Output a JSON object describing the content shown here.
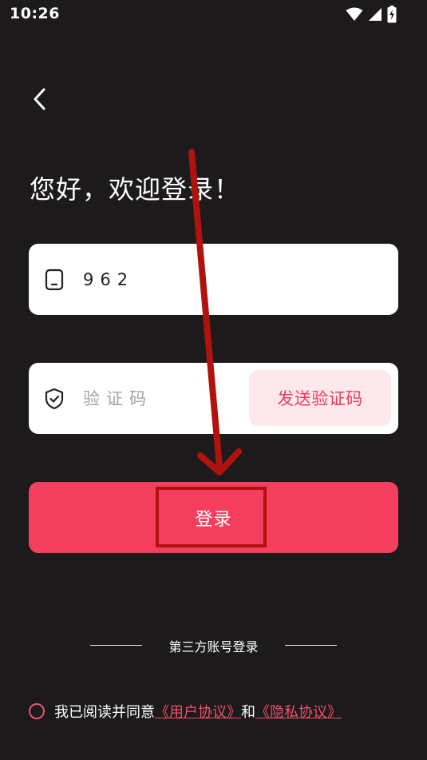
{
  "status_bar": {
    "time": "10:26",
    "icons": [
      "wifi-icon",
      "signal-icon",
      "battery-charging-icon"
    ]
  },
  "nav": {
    "back_icon": "chevron-left-icon"
  },
  "greeting": "您好，欢迎登录！",
  "phone_field": {
    "icon": "phone-icon",
    "value": "962"
  },
  "code_field": {
    "icon": "shield-check-icon",
    "placeholder": "验证码",
    "send_button_label": "发送验证码"
  },
  "login_button": {
    "label": "登录"
  },
  "third_party": {
    "label": "第三方账号登录"
  },
  "agreement": {
    "text": "我已阅读并同意",
    "user_agreement": "《用户协议》",
    "conjunction": "和",
    "privacy_agreement": "《隐私协议》"
  },
  "colors": {
    "background": "#1c1a1b",
    "accent": "#f33f5d",
    "send_button_bg": "#fde9ec",
    "annotation_red": "#b0120e"
  }
}
